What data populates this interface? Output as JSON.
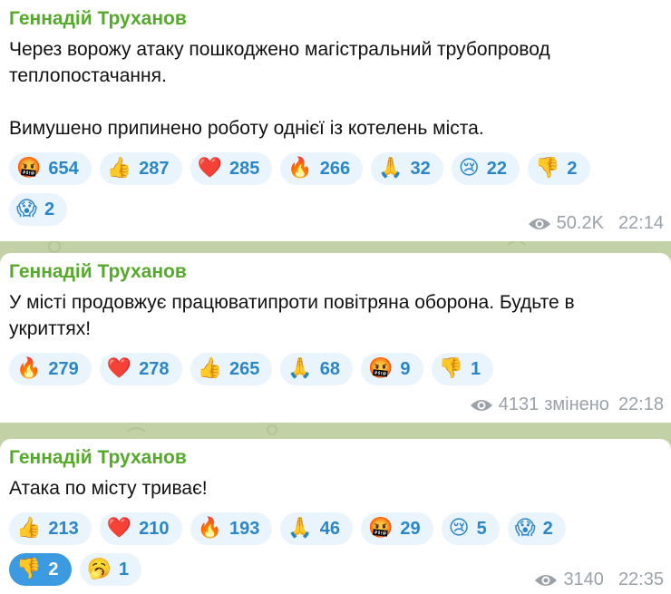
{
  "messages": [
    {
      "author": "Геннадій Труханов",
      "text": "Через ворожу атаку пошкоджено магістральний трубопровод\nтеплопостачання.\n\nВимушено припинено роботу однієї із котелень міста.",
      "reactions": [
        {
          "emoji": "🤬",
          "icon": "angry-face-icon",
          "count": "654"
        },
        {
          "emoji": "👍",
          "icon": "thumbs-up-icon",
          "count": "287"
        },
        {
          "emoji": "❤️",
          "icon": "heart-icon",
          "count": "285"
        },
        {
          "emoji": "🔥",
          "icon": "fire-icon",
          "count": "266"
        },
        {
          "emoji": "🙏",
          "icon": "praying-hands-icon",
          "count": "32"
        },
        {
          "emoji": "😢",
          "icon": "crying-face-icon",
          "count": "22"
        },
        {
          "emoji": "👎",
          "icon": "thumbs-down-icon",
          "count": "2"
        },
        {
          "emoji": "😱",
          "icon": "screaming-face-icon",
          "count": "2"
        }
      ],
      "views": "50.2K",
      "edited": "",
      "time": "22:14"
    },
    {
      "author": "Геннадій Труханов",
      "text": "У місті продовжує працюватипроти повітряна оборона. Будьте в\nукриттях!",
      "reactions": [
        {
          "emoji": "🔥",
          "icon": "fire-icon",
          "count": "279"
        },
        {
          "emoji": "❤️",
          "icon": "heart-icon",
          "count": "278"
        },
        {
          "emoji": "👍",
          "icon": "thumbs-up-icon",
          "count": "265"
        },
        {
          "emoji": "🙏",
          "icon": "praying-hands-icon",
          "count": "68"
        },
        {
          "emoji": "🤬",
          "icon": "angry-face-icon",
          "count": "9"
        },
        {
          "emoji": "👎",
          "icon": "thumbs-down-icon",
          "count": "1"
        }
      ],
      "views": "4131",
      "edited": "змінено",
      "time": "22:18"
    },
    {
      "author": "Геннадій Труханов",
      "text": "Атака по місту триває!",
      "reactions": [
        {
          "emoji": "👍",
          "icon": "thumbs-up-icon",
          "count": "213"
        },
        {
          "emoji": "❤️",
          "icon": "heart-icon",
          "count": "210"
        },
        {
          "emoji": "🔥",
          "icon": "fire-icon",
          "count": "193"
        },
        {
          "emoji": "🙏",
          "icon": "praying-hands-icon",
          "count": "46"
        },
        {
          "emoji": "🤬",
          "icon": "angry-face-icon",
          "count": "29"
        },
        {
          "emoji": "😢",
          "icon": "crying-face-icon",
          "count": "5"
        },
        {
          "emoji": "😱",
          "icon": "screaming-face-icon",
          "count": "2"
        },
        {
          "emoji": "👎",
          "icon": "thumbs-down-icon",
          "count": "2",
          "selected": true
        },
        {
          "emoji": "🥱",
          "icon": "yawning-face-icon",
          "count": "1"
        }
      ],
      "views": "3140",
      "edited": "",
      "time": "22:35"
    }
  ],
  "colors": {
    "author": "#55a92b",
    "reaction_bg": "#e9f4fc",
    "reaction_text": "#2b86c8",
    "reaction_selected_bg": "#3c9ae0",
    "meta": "#9aa1a8",
    "chat_bg": "#c3d2a6"
  }
}
